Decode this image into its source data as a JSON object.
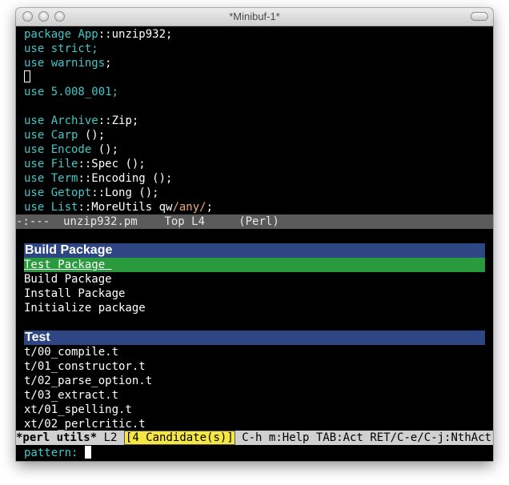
{
  "window": {
    "title": "*Minibuf-1*"
  },
  "code_lines": [
    [
      {
        "t": "package ",
        "c": "kw"
      },
      {
        "t": "App",
        "c": "kw"
      },
      {
        "t": "::unzip932;",
        "c": ""
      }
    ],
    [
      {
        "t": "use ",
        "c": "kw"
      },
      {
        "t": "strict;",
        "c": "kw"
      }
    ],
    [
      {
        "t": "use ",
        "c": "kw"
      },
      {
        "t": "warnings",
        "c": "kw"
      },
      {
        "t": ";",
        "c": ""
      }
    ],
    [
      {
        "t": "",
        "c": "cursor"
      }
    ],
    [
      {
        "t": "use ",
        "c": "kw"
      },
      {
        "t": "5.008_001;",
        "c": "kw"
      }
    ],
    [],
    [
      {
        "t": "use ",
        "c": "kw"
      },
      {
        "t": "Archive",
        "c": "kw"
      },
      {
        "t": "::Zip;",
        "c": ""
      }
    ],
    [
      {
        "t": "use ",
        "c": "kw"
      },
      {
        "t": "Carp",
        "c": "kw"
      },
      {
        "t": " ();",
        "c": ""
      }
    ],
    [
      {
        "t": "use ",
        "c": "kw"
      },
      {
        "t": "Encode",
        "c": "kw"
      },
      {
        "t": " ();",
        "c": ""
      }
    ],
    [
      {
        "t": "use ",
        "c": "kw"
      },
      {
        "t": "File",
        "c": "kw"
      },
      {
        "t": "::Spec ();",
        "c": ""
      }
    ],
    [
      {
        "t": "use ",
        "c": "kw"
      },
      {
        "t": "Term",
        "c": "kw"
      },
      {
        "t": "::Encoding ();",
        "c": ""
      }
    ],
    [
      {
        "t": "use ",
        "c": "kw"
      },
      {
        "t": "Getopt",
        "c": "kw"
      },
      {
        "t": "::Long ();",
        "c": ""
      }
    ],
    [
      {
        "t": "use ",
        "c": "kw"
      },
      {
        "t": "List",
        "c": "kw"
      },
      {
        "t": "::MoreUtils qw",
        "c": ""
      },
      {
        "t": "/any/",
        "c": "str"
      },
      {
        "t": ";",
        "c": ""
      }
    ]
  ],
  "modeline_top": {
    "flags": "-:---",
    "buffer": "unzip932.pm",
    "position": "Top L4",
    "mode": "(Perl)"
  },
  "anything": {
    "sections": [
      {
        "header": "Build Package",
        "items": [
          "Test Package ",
          "Build Package",
          "Install Package",
          "Initialize package"
        ],
        "selected_index": 0
      },
      {
        "header": "Test",
        "items": [
          "t/00_compile.t",
          "t/01_constructor.t",
          "t/02_parse_option.t",
          "t/03_extract.t",
          "xt/01_spelling.t",
          "xt/02_perlcritic.t"
        ],
        "selected_index": -1
      }
    ]
  },
  "modeline_bottom": {
    "buffer": "*perl utils*",
    "line": "L2",
    "candidates": "[4 Candidate(s)]",
    "help": "C-h m:Help TAB:Act RET/C-e/C-j:NthAct --"
  },
  "minibuffer": {
    "prompt": "pattern: "
  },
  "colors": {
    "keyword": "#40c8c8",
    "string": "#f0a870",
    "header": "#2e4684",
    "selection": "#2a9a3e",
    "candidates_bg": "#f5e642"
  }
}
